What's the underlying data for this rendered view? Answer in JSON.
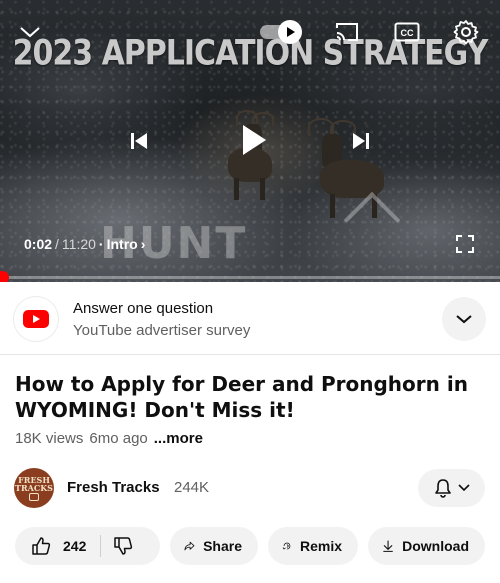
{
  "player": {
    "video_title_overlay": "2023 APPLICATION STRATEGY",
    "watermark": "HUNT",
    "current_time": "0:02",
    "separator": "/",
    "duration": "11:20",
    "chapter_dot": "·",
    "chapter": "Intro",
    "chapter_chevron": "›",
    "progress_fraction": 0.003,
    "autoplay_on": true,
    "icons": [
      "collapse-chevron-icon",
      "autoplay-toggle",
      "cast-icon",
      "captions-icon",
      "settings-gear-icon",
      "previous-icon",
      "play-icon",
      "next-icon",
      "fullscreen-icon"
    ]
  },
  "survey": {
    "title": "Answer one question",
    "subtitle": "YouTube advertiser survey"
  },
  "video": {
    "title": "How to Apply for Deer and Pronghorn in WYOMING! Don't Miss it!",
    "views": "18K views",
    "age": "6mo ago",
    "more": "...more"
  },
  "channel": {
    "avatar_line1": "FRESH",
    "avatar_line2": "TRACKS",
    "name": "Fresh Tracks",
    "subscribers": "244K"
  },
  "actions": {
    "likes": "242",
    "share": "Share",
    "remix": "Remix",
    "download": "Download"
  },
  "colors": {
    "accent_red": "#ff0000",
    "pill_bg": "#f2f2f2",
    "secondary_text": "#606060"
  }
}
